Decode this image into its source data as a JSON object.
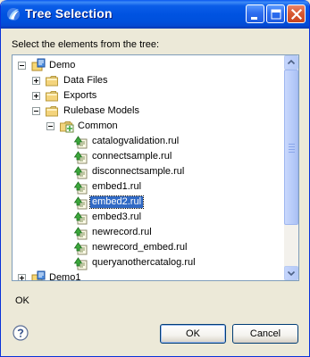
{
  "window": {
    "title": "Tree Selection",
    "instruction": "Select the elements from the tree:",
    "status_message": "OK"
  },
  "tree": {
    "items": [
      {
        "label": "Demo",
        "level": 0,
        "type": "project",
        "expander": "expanded"
      },
      {
        "label": "Data Files",
        "level": 1,
        "type": "folder",
        "expander": "collapsed"
      },
      {
        "label": "Exports",
        "level": 1,
        "type": "folder",
        "expander": "collapsed"
      },
      {
        "label": "Rulebase Models",
        "level": 1,
        "type": "folder",
        "expander": "expanded"
      },
      {
        "label": "Common",
        "level": 2,
        "type": "model-folder",
        "expander": "expanded"
      },
      {
        "label": "catalogvalidation.rul",
        "level": 3,
        "type": "rule-file",
        "expander": "none"
      },
      {
        "label": "connectsample.rul",
        "level": 3,
        "type": "rule-file",
        "expander": "none"
      },
      {
        "label": "disconnectsample.rul",
        "level": 3,
        "type": "rule-file",
        "expander": "none"
      },
      {
        "label": "embed1.rul",
        "level": 3,
        "type": "rule-file",
        "expander": "none"
      },
      {
        "label": "embed2.rul",
        "level": 3,
        "type": "rule-file",
        "expander": "none",
        "selected": true
      },
      {
        "label": "embed3.rul",
        "level": 3,
        "type": "rule-file",
        "expander": "none"
      },
      {
        "label": "newrecord.rul",
        "level": 3,
        "type": "rule-file",
        "expander": "none"
      },
      {
        "label": "newrecord_embed.rul",
        "level": 3,
        "type": "rule-file",
        "expander": "none"
      },
      {
        "label": "queryanothercatalog.rul",
        "level": 3,
        "type": "rule-file",
        "expander": "none"
      },
      {
        "label": "Demo1",
        "level": 0,
        "type": "project",
        "expander": "collapsed"
      }
    ]
  },
  "buttons": {
    "ok_label": "OK",
    "cancel_label": "Cancel"
  },
  "icons": {
    "title": "app-logo-icon",
    "help": "help-icon",
    "minimize": "minimize-icon",
    "maximize": "maximize-icon",
    "close": "close-icon"
  },
  "colors": {
    "titlebar": "#0053e1",
    "selection": "#316ac5",
    "folder": "#f4d47c",
    "rule_file_green": "#3ca83c"
  }
}
